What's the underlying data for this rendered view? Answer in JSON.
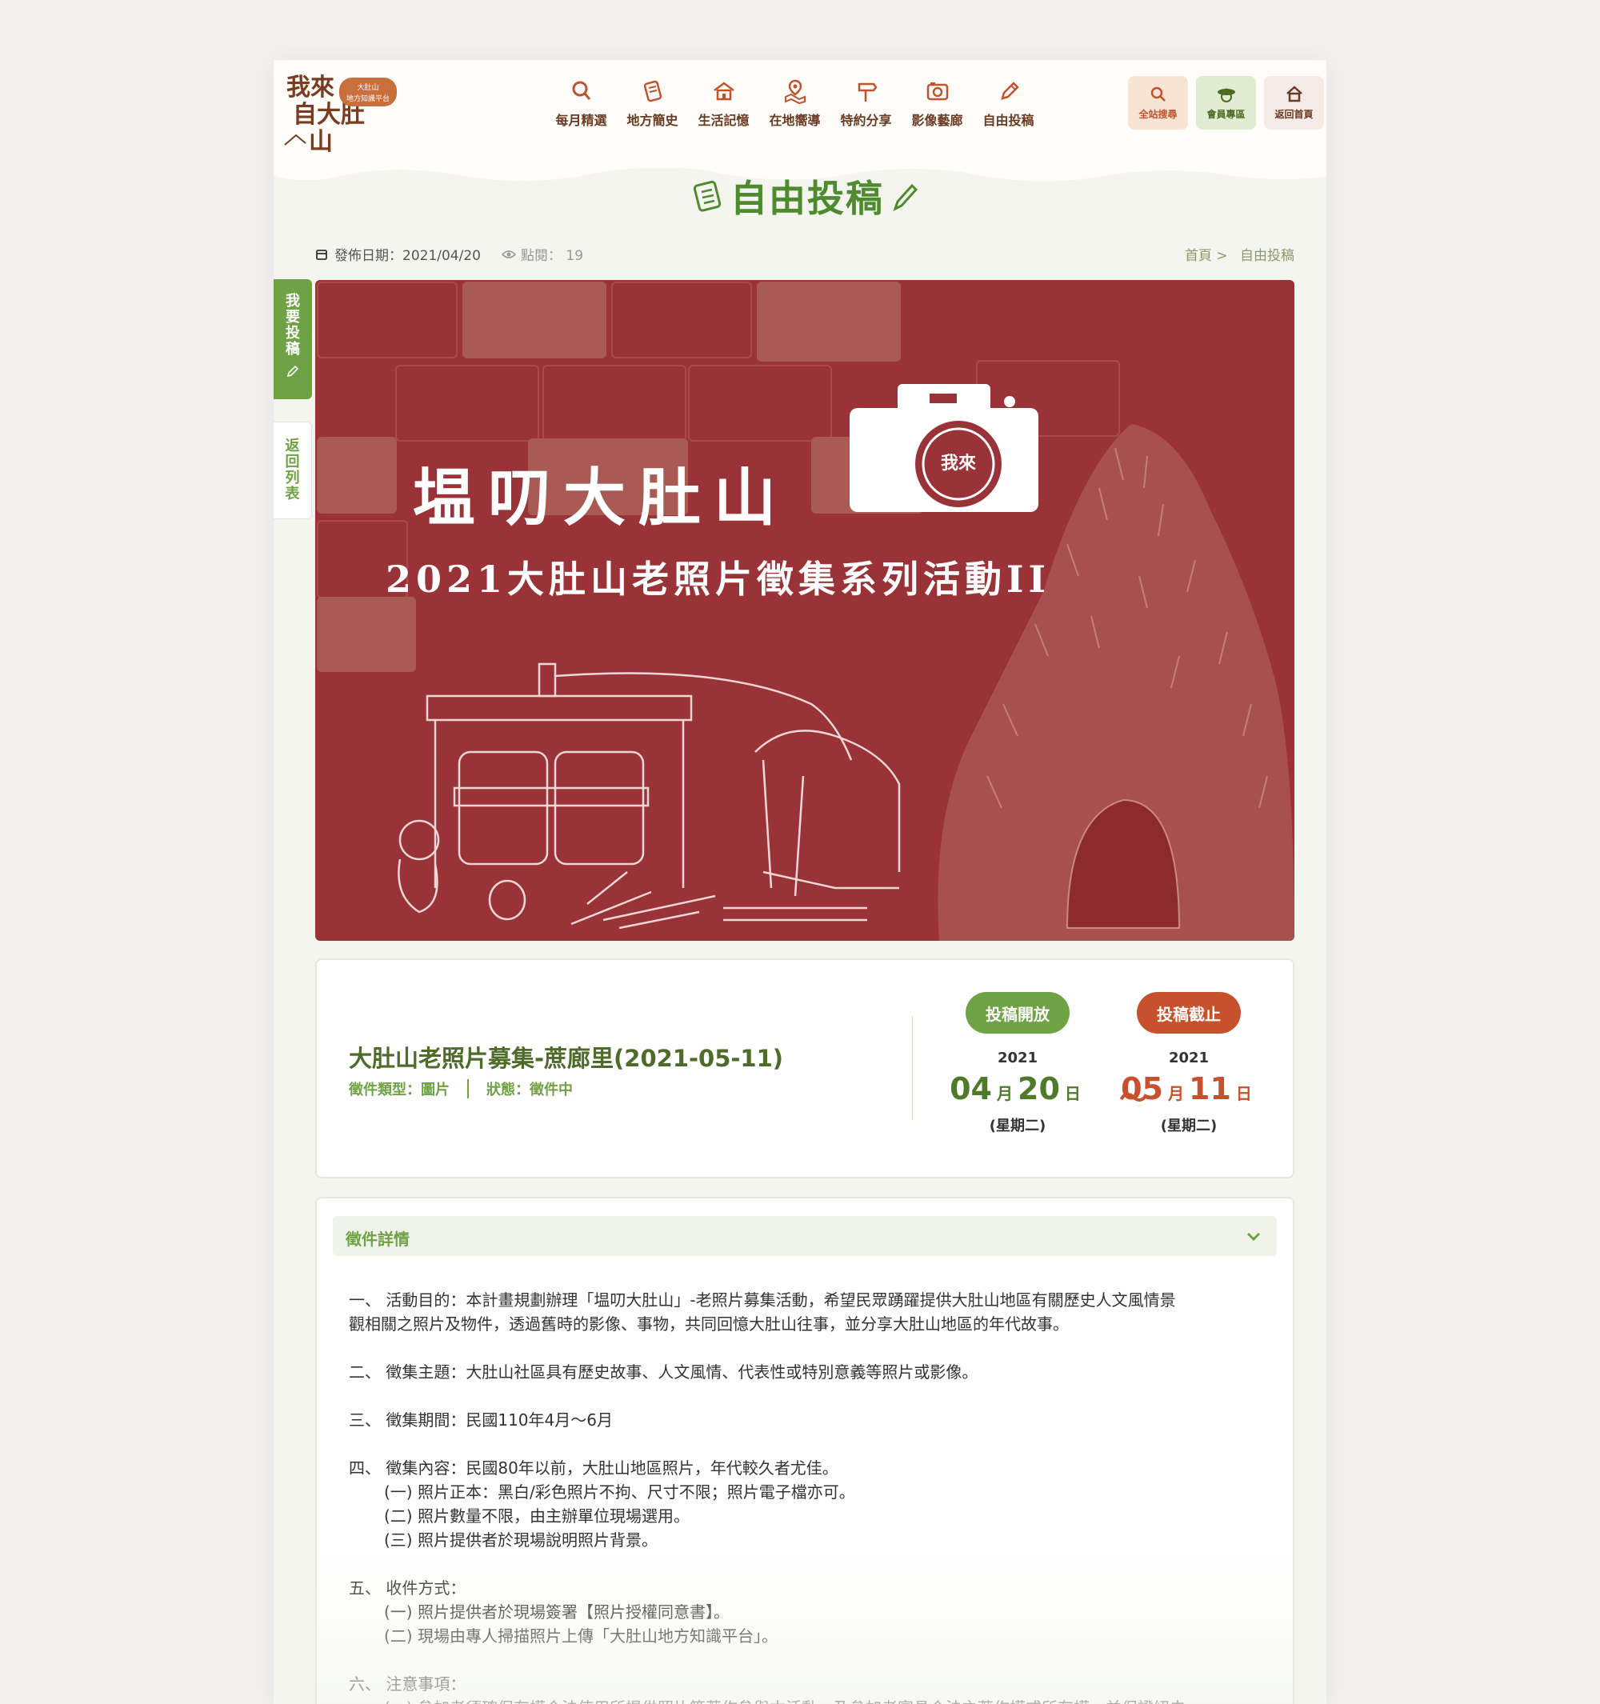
{
  "header": {
    "logo_text": "我來自大肚山",
    "logo_badge": "大肚山 地方知識平台",
    "nav": [
      {
        "label": "每月精選",
        "icon": "search-icon"
      },
      {
        "label": "地方簡史",
        "icon": "scroll-icon"
      },
      {
        "label": "生活記憶",
        "icon": "house-icon"
      },
      {
        "label": "在地嚮導",
        "icon": "map-pin-icon"
      },
      {
        "label": "特約分享",
        "icon": "signpost-icon"
      },
      {
        "label": "影像藝廊",
        "icon": "camera-icon"
      },
      {
        "label": "自由投稿",
        "icon": "pencil-icon"
      }
    ],
    "quick": {
      "search": "全站搜尋",
      "member": "會員專區",
      "home": "返回首頁"
    }
  },
  "page": {
    "title": "自由投稿",
    "publish_date": "發佈日期：2021/04/20",
    "views": "點閱： 19",
    "breadcrumb": {
      "home": "首頁 >",
      "current": "自由投稿"
    }
  },
  "side": {
    "submit_chars": [
      "我",
      "要",
      "投",
      "稿"
    ],
    "back_chars": [
      "返",
      "回",
      "列",
      "表"
    ]
  },
  "banner": {
    "title": "塭叨大肚山",
    "subtitle": "2021大肚山老照片徵集系列活動II",
    "colors": {
      "bg": "#993337",
      "ink": "#ffffff"
    }
  },
  "collection": {
    "title": "大肚山老照片募集-蔗廊里(2021-05-11)",
    "type": "徵件類型：圖片",
    "status": "狀態：徵件中",
    "open": {
      "label": "投稿開放",
      "year": "2021",
      "month": "04",
      "day": "20",
      "weekday": "(星期二)"
    },
    "close": {
      "label": "投稿截止",
      "year": "2021",
      "month": "05",
      "day": "11",
      "weekday": "(星期二)"
    },
    "month_unit": "月",
    "day_unit": "日",
    "tilde": "～"
  },
  "details": {
    "heading": "徵件詳情",
    "p1_line1": "一、 活動目的：本計畫規劃辦理「塭叨大肚山」-老照片募集活動，希望民眾踴躍提供大肚山地區有關歷史人文風情景",
    "p1_line2": "觀相關之照片及物件，透過舊時的影像、事物，共同回憶大肚山往事，並分享大肚山地區的年代故事。",
    "p2": "二、 徵集主題：大肚山社區具有歷史故事、人文風情、代表性或特別意義等照片或影像。",
    "p3": "三、 徵集期間：民國110年4月～6月",
    "p4": "四、 徵集內容：民國80年以前，大肚山地區照片，年代較久者尤佳。",
    "p4_items": [
      "(一) 照片正本：黑白/彩色照片不拘、尺寸不限；照片電子檔亦可。",
      "(二) 照片數量不限，由主辦單位現場選用。",
      "(三) 照片提供者於現場說明照片背景。"
    ],
    "p5": "五、 收件方式：",
    "p5_items": [
      "(一) 照片提供者於現場簽署【照片授權同意書】。",
      "(二) 現場由專人掃描照片上傳「大肚山地方知識平台」。"
    ],
    "p6": "六、 注意事項：",
    "p6_items": [
      "(一) 參加者須確保有權合法使用所提供照片等著作參與本活動，及參加者實具合法之著作權或所有權，並保證絕未"
    ]
  },
  "colors": {
    "green": "#6fa244",
    "dark_green": "#4e6b2a",
    "orange": "#c7512d",
    "brown": "#6b3a22"
  }
}
